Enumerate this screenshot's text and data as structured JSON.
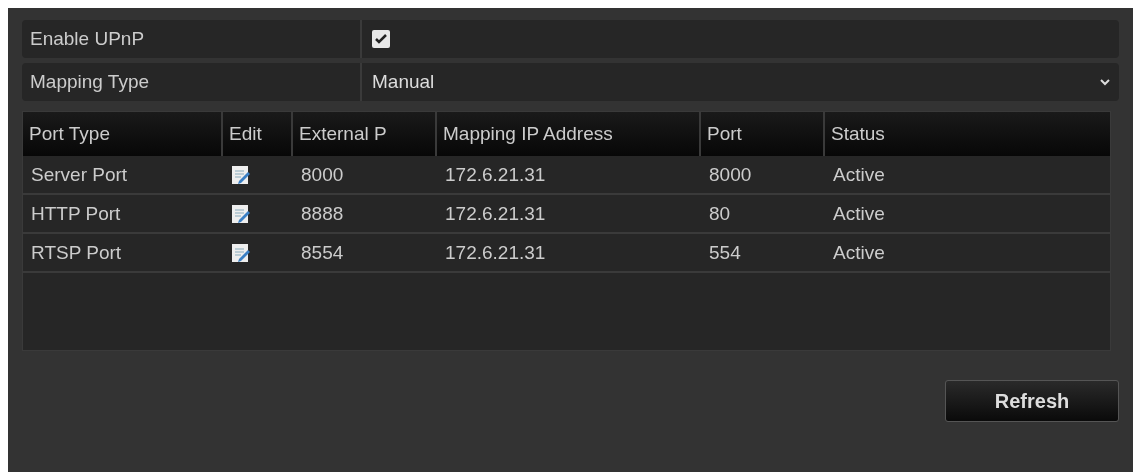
{
  "enable_upnp": {
    "label": "Enable UPnP",
    "checked": true
  },
  "mapping_type": {
    "label": "Mapping Type",
    "value": "Manual"
  },
  "table": {
    "columns": [
      "Port Type",
      "Edit",
      "External P",
      "Mapping IP Address",
      "Port",
      "Status"
    ],
    "rows": [
      {
        "port_type": "Server Port",
        "external_port": "8000",
        "mapping_ip": "172.6.21.31",
        "port": "8000",
        "status": "Active"
      },
      {
        "port_type": "HTTP Port",
        "external_port": "8888",
        "mapping_ip": "172.6.21.31",
        "port": "80",
        "status": "Active"
      },
      {
        "port_type": "RTSP Port",
        "external_port": "8554",
        "mapping_ip": "172.6.21.31",
        "port": "554",
        "status": "Active"
      }
    ]
  },
  "buttons": [
    "Refresh"
  ]
}
